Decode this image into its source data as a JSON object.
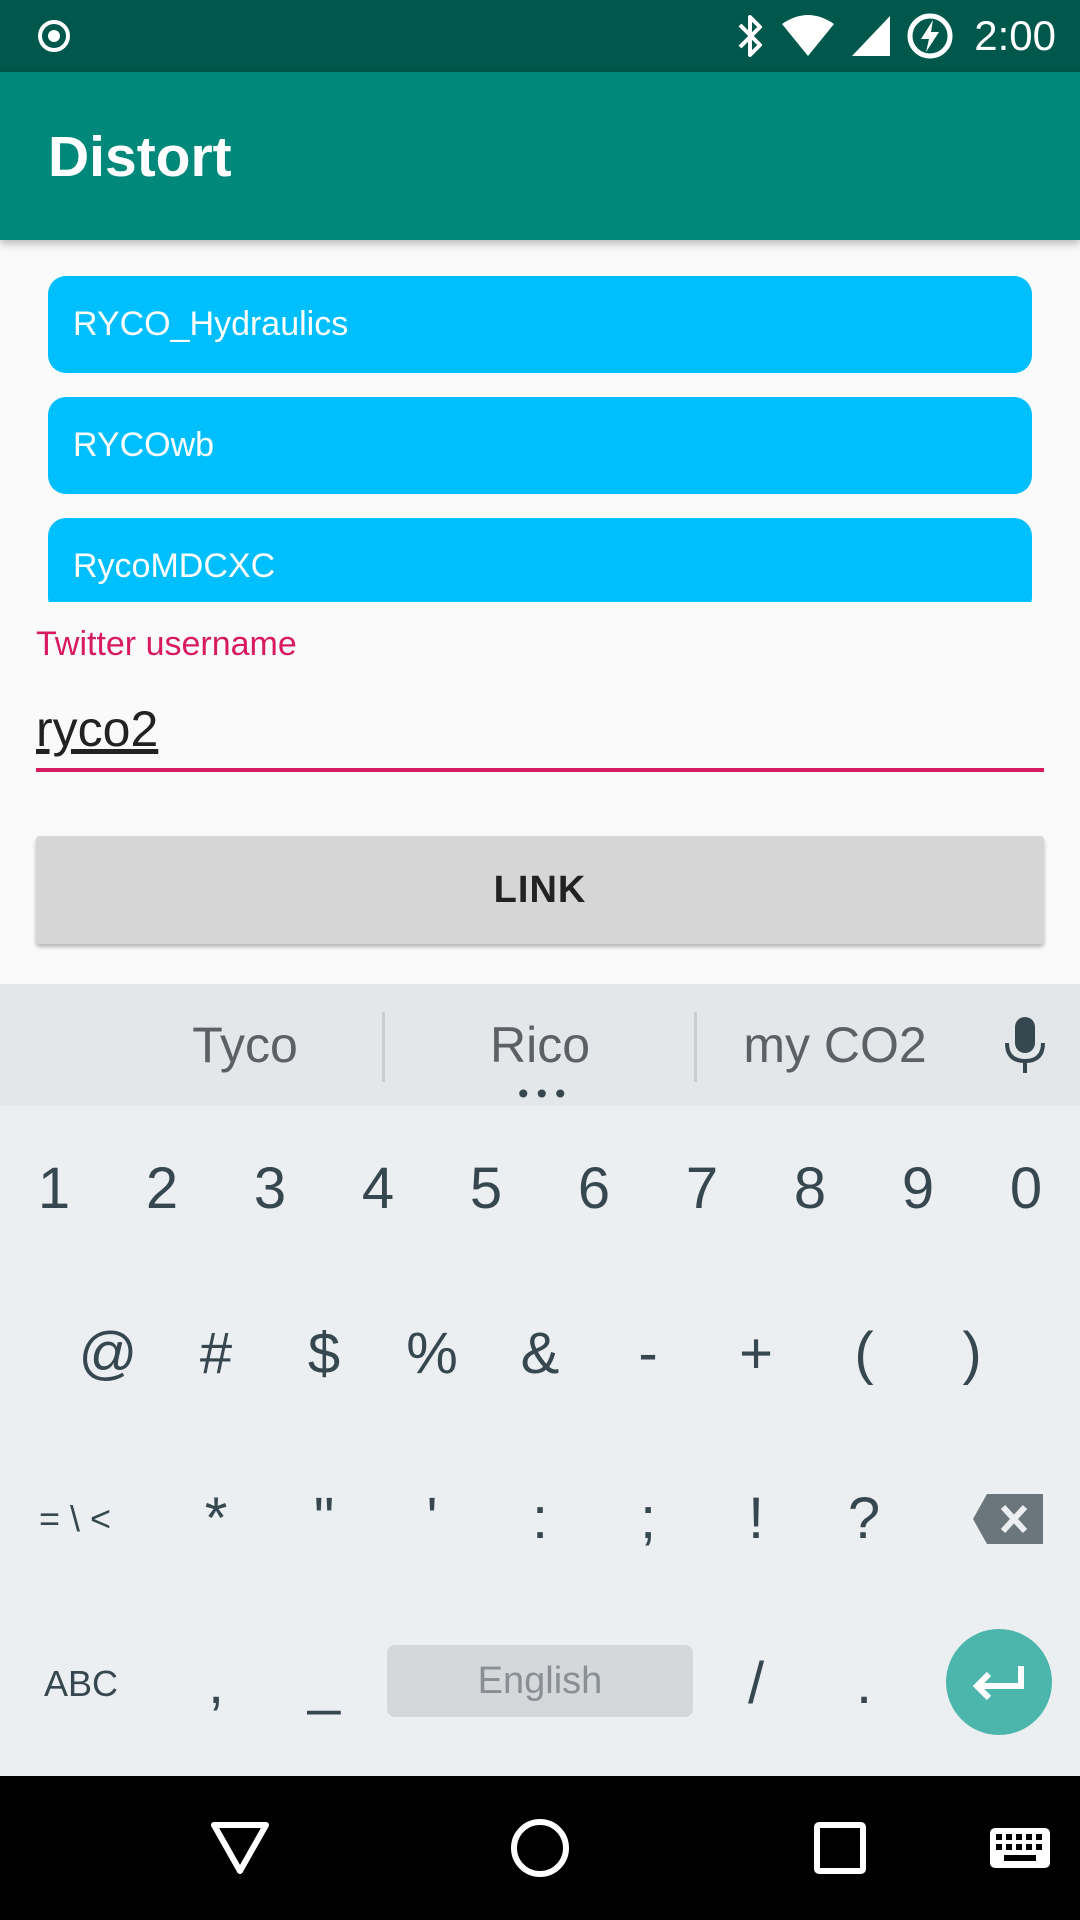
{
  "status_bar": {
    "time": "2:00",
    "icons": [
      "record-icon",
      "bluetooth-icon",
      "wifi-icon",
      "signal-icon",
      "battery-charging-icon"
    ]
  },
  "app_bar": {
    "title": "Distort"
  },
  "accounts": [
    {
      "label": "RYCO_Hydraulics"
    },
    {
      "label": "RYCOwb"
    },
    {
      "label": "RycoMDCXC"
    }
  ],
  "username_field": {
    "label": "Twitter username",
    "value": "ryco2"
  },
  "link_button": {
    "label": "LINK"
  },
  "keyboard": {
    "suggestions": [
      "Tyco",
      "Rico",
      "my CO2"
    ],
    "rows": [
      [
        "1",
        "2",
        "3",
        "4",
        "5",
        "6",
        "7",
        "8",
        "9",
        "0"
      ],
      [
        "@",
        "#",
        "$",
        "%",
        "&",
        "-",
        "+",
        "(",
        ")"
      ],
      [
        "= \\ <",
        "*",
        "\"",
        "'",
        ":",
        ";",
        "!",
        "?"
      ],
      [
        "ABC",
        ",",
        "_"
      ]
    ],
    "space_label": "English",
    "after_space": [
      "/",
      "."
    ],
    "icons": [
      "microphone-icon",
      "backspace-icon",
      "enter-icon"
    ]
  },
  "nav_bar": {
    "icons": [
      "back-icon",
      "home-icon",
      "recents-icon",
      "keyboard-switch-icon"
    ]
  },
  "colors": {
    "status_bar": "#00574b",
    "app_bar": "#00897b",
    "account_item": "#00bfff",
    "accent": "#d81b60",
    "enter_key": "#4db6ac"
  }
}
